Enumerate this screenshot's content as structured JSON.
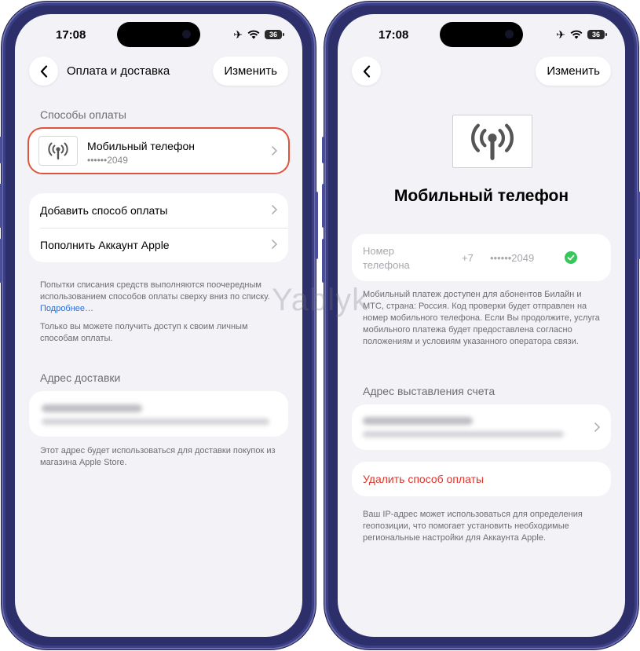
{
  "watermark": "Yablyk",
  "status": {
    "time": "17:08",
    "battery": "36"
  },
  "left": {
    "nav": {
      "title": "Оплата и доставка",
      "edit": "Изменить"
    },
    "payment_section": "Способы оплаты",
    "payment_method": {
      "title": "Мобильный телефон",
      "masked_number": "••••••2049",
      "icon": "antenna-icon"
    },
    "actions": [
      "Добавить способ оплаты",
      "Пополнить Аккаунт Apple"
    ],
    "note1": "Попытки списания средств выполняются поочередным использованием способов оплаты сверху вниз по списку.",
    "note1_link": "Подробнее…",
    "note2": "Только вы можете получить доступ к своим личным способам оплаты.",
    "shipping_section": "Адрес доставки",
    "shipping_note": "Этот адрес будет использоваться для доставки покупок из магазина Apple Store."
  },
  "right": {
    "nav": {
      "edit": "Изменить"
    },
    "title": "Мобильный телефон",
    "phone_field": {
      "label": "Номер телефона",
      "prefix": "+7",
      "number": "••••••2049"
    },
    "info": "Мобильный платеж доступен для абонентов Билайн и МТС, страна: Россия. Код проверки будет отправлен на номер мобильного телефона. Если Вы продолжите, услуга мобильного платежа будет предоставлена согласно положениям и условиям указанного оператора связи.",
    "billing_section": "Адрес выставления счета",
    "delete": "Удалить способ оплаты",
    "footer": "Ваш IP-адрес может использоваться для определения геопозиции, что помогает установить необходимые региональные настройки для Аккаунта Apple."
  },
  "colors": {
    "accent_red": "#e0523b",
    "delete_red": "#e0342b",
    "link": "#2e6fd8",
    "check": "#34c759"
  }
}
